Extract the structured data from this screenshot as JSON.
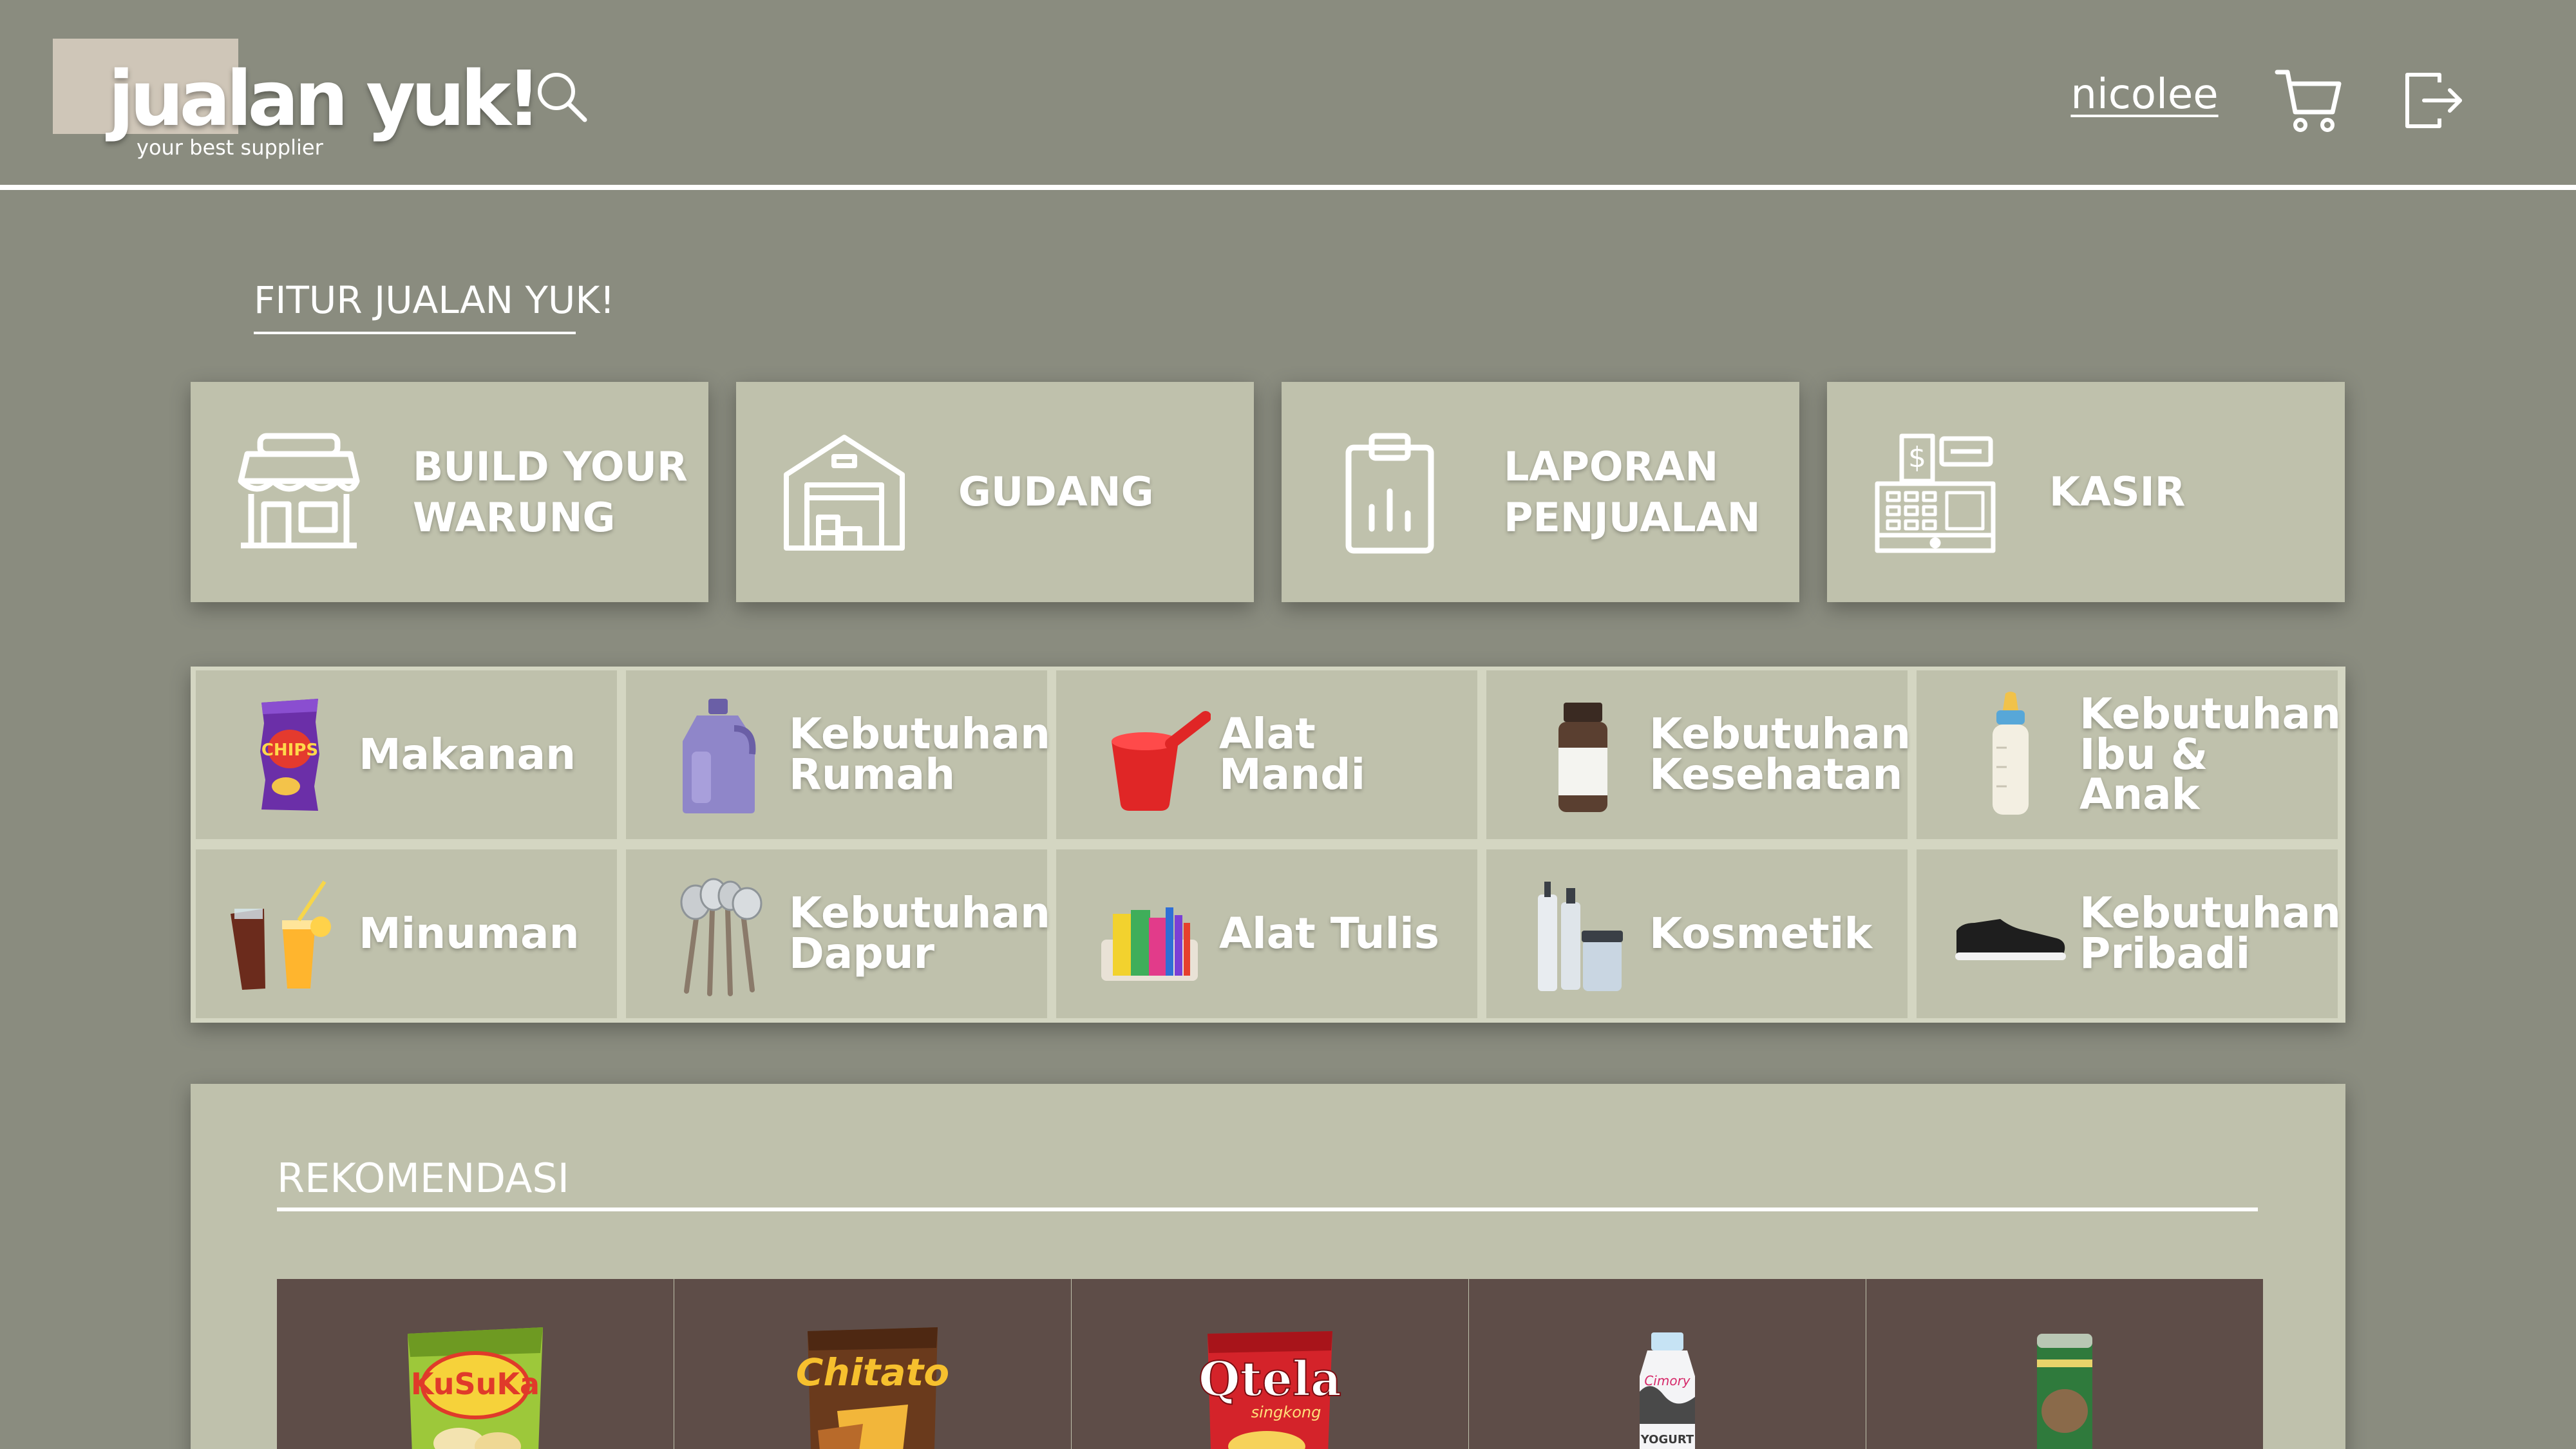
{
  "header": {
    "logo_text": "jualan yuk!",
    "logo_tagline": "your best supplier",
    "username": "nicolee",
    "icons": [
      "search-icon",
      "cart-icon",
      "logout-icon"
    ]
  },
  "features": {
    "title": "FITUR JUALAN YUK!",
    "items": [
      {
        "label": "BUILD YOUR WARUNG",
        "icon": "store-icon"
      },
      {
        "label": "GUDANG",
        "icon": "warehouse-icon"
      },
      {
        "label": "LAPORAN PENJUALAN",
        "icon": "report-icon"
      },
      {
        "label": "KASIR",
        "icon": "cash-register-icon"
      }
    ]
  },
  "categories": {
    "items": [
      {
        "label": "Makanan",
        "icon": "chips-icon"
      },
      {
        "label": "Kebutuhan Rumah",
        "icon": "detergent-bottle-icon"
      },
      {
        "label": "Alat Mandi",
        "icon": "water-dipper-icon"
      },
      {
        "label": "Kebutuhan Kesehatan",
        "icon": "medicine-bottle-icon"
      },
      {
        "label": "Kebutuhan Ibu & Anak",
        "icon": "baby-bottle-icon"
      },
      {
        "label": "Minuman",
        "icon": "drinks-icon"
      },
      {
        "label": "Kebutuhan Dapur",
        "icon": "kitchen-utensils-icon"
      },
      {
        "label": "Alat Tulis",
        "icon": "stationery-icon"
      },
      {
        "label": "Kosmetik",
        "icon": "cosmetics-icon"
      },
      {
        "label": "Kebutuhan Pribadi",
        "icon": "shoe-icon"
      }
    ]
  },
  "recommendations": {
    "title": "REKOMENDASI",
    "items": [
      {
        "image": "kusuka-chips-image"
      },
      {
        "image": "chitato-chips-image"
      },
      {
        "image": "qtela-singkong-image"
      },
      {
        "image": "cimory-yogurt-drink-image"
      },
      {
        "image": "tea-can-image"
      }
    ]
  },
  "colors": {
    "background": "#8a8c7f",
    "card": "#bfc1ac",
    "grid_gap": "#d4d6c2",
    "product_card": "#5e4d48",
    "logo_block": "#cfc6b8",
    "text": "#ffffff"
  }
}
